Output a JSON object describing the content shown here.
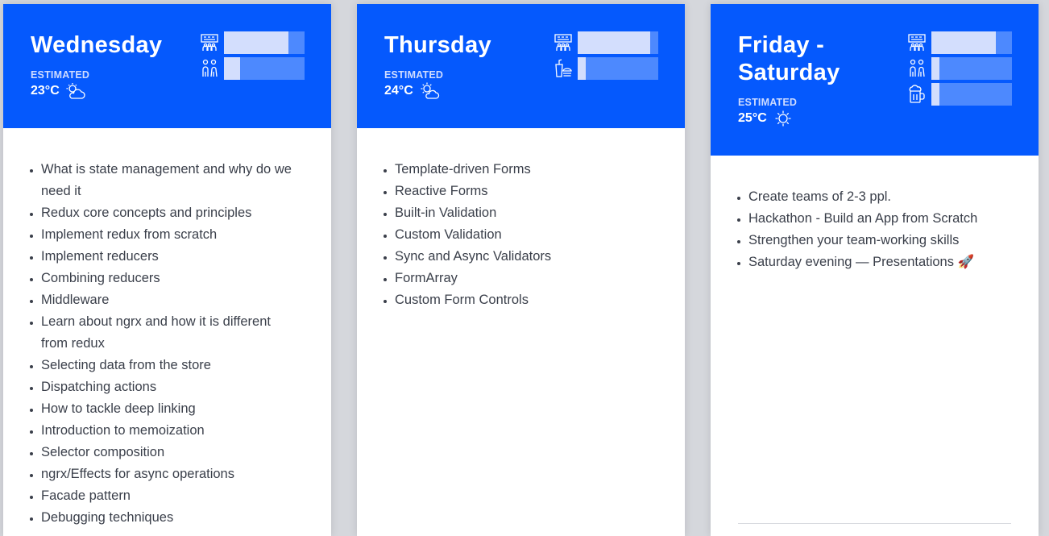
{
  "estimated_label": "ESTIMATED",
  "colors": {
    "header_bg": "#0559fd",
    "meter_bg": "#4d89fe",
    "meter_fill": "#d3defd",
    "page_bg": "#d5d7dc"
  },
  "cards": [
    {
      "title_lines": [
        "Wednesday"
      ],
      "temperature": "23°C",
      "weather_icon": "partly-cloudy-icon",
      "meters": [
        {
          "icon": "presentation-icon",
          "level_pct": 80
        },
        {
          "icon": "people-icon",
          "level_pct": 20
        }
      ],
      "topics": [
        "What is state management and why do we need it",
        "Redux core concepts and principles",
        "Implement redux from scratch",
        "Implement reducers",
        "Combining reducers",
        "Middleware",
        "Learn about ngrx and how it is different from redux",
        "Selecting data from the store",
        "Dispatching actions",
        "How to tackle deep linking",
        "Introduction to memoization",
        "Selector composition",
        "ngrx/Effects for async operations",
        "Facade pattern",
        "Debugging techniques"
      ]
    },
    {
      "title_lines": [
        "Thursday"
      ],
      "temperature": "24°C",
      "weather_icon": "sun-behind-cloud-icon",
      "meters": [
        {
          "icon": "presentation-icon",
          "level_pct": 90
        },
        {
          "icon": "food-icon",
          "level_pct": 10
        }
      ],
      "topics": [
        "Template-driven Forms",
        "Reactive Forms",
        "Built-in Validation",
        "Custom Validation",
        "Sync and Async Validators",
        "FormArray",
        "Custom Form Controls"
      ]
    },
    {
      "title_lines": [
        "Friday -",
        "Saturday"
      ],
      "temperature": "25°C",
      "weather_icon": "sun-icon",
      "meters": [
        {
          "icon": "presentation-icon",
          "level_pct": 80
        },
        {
          "icon": "people-icon",
          "level_pct": 10
        },
        {
          "icon": "beer-icon",
          "level_pct": 10
        }
      ],
      "topics": [
        "Create teams of 2-3 ppl.",
        "Hackathon - Build an App from Scratch",
        "Strengthen your team-working skills",
        "Saturday evening — Presentations 🚀"
      ]
    }
  ]
}
